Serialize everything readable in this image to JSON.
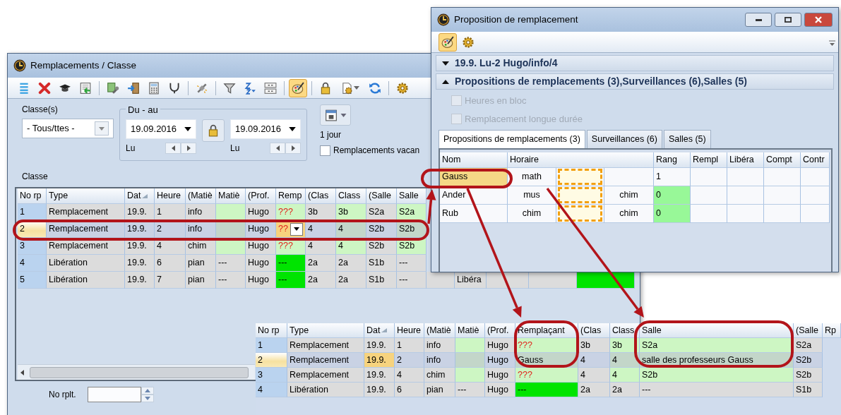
{
  "main_window": {
    "title": "Remplacements / Classe",
    "toolbar": [
      {
        "active": false
      },
      {
        "active": false
      },
      {
        "active": false
      },
      {
        "active": false
      },
      {
        "active": false
      },
      {
        "active": false
      },
      {
        "active": false
      },
      {
        "active": false
      },
      {
        "active": false
      },
      {
        "active": false
      },
      {
        "active": false
      },
      {
        "active": false
      },
      {
        "active": true
      },
      {
        "active": false
      },
      {
        "active": false
      },
      {
        "active": false
      },
      {
        "active": false
      }
    ],
    "filters": {
      "classes_label": "Classe(s)",
      "classes_value": "- Tous/ttes -",
      "range_label": "Du - au",
      "from_date": "19.09.2016",
      "from_day": "Lu",
      "to_date": "19.09.2016",
      "to_day": "Lu",
      "period": "1 jour",
      "vacant_label": "Remplacements vacan",
      "vacant_checked": false,
      "grouping_label": "Classe"
    },
    "table": {
      "columns": [
        "No rp",
        "Type",
        "Dat",
        "Heure",
        "(Matiè",
        "Matiè",
        "(Prof.",
        "Remp",
        "(Clas",
        "Class",
        "(Salle",
        "Salle"
      ],
      "rows": [
        {
          "selected": false,
          "kind": "replacement",
          "cells": [
            "1",
            "Remplacement",
            "19.9.",
            "1",
            "info",
            {
              "kind": "empty"
            },
            "Hugo",
            {
              "kind": "missing",
              "text": "???"
            },
            "3b",
            "3b",
            "S2a",
            "S2a"
          ]
        },
        {
          "selected": true,
          "kind": "replacement",
          "cells": [
            "2",
            "Remplacement",
            "19.9.",
            "2",
            "info",
            {
              "kind": "empty"
            },
            "Hugo",
            {
              "kind": "editing",
              "text": "??"
            },
            "4",
            "4",
            "S2b",
            "S2b"
          ]
        },
        {
          "selected": false,
          "kind": "replacement",
          "cells": [
            "3",
            "Remplacement",
            "19.9.",
            "4",
            "chim",
            {
              "kind": "empty"
            },
            "Hugo",
            {
              "kind": "missing",
              "text": "???"
            },
            "4",
            "4",
            "S2b",
            "S2b"
          ]
        },
        {
          "selected": false,
          "kind": "release",
          "cells": [
            "4",
            "Libération",
            "19.9.",
            "6",
            "pian",
            "---",
            "Hugo",
            {
              "kind": "released",
              "text": "---"
            },
            "2a",
            "2a",
            "S1b",
            "---"
          ]
        },
        {
          "selected": false,
          "kind": "release",
          "cells": [
            "5",
            "Libération",
            "19.9.",
            "7",
            "pian",
            "---",
            "Hugo",
            {
              "kind": "released",
              "text": "---"
            },
            "2a",
            "2a",
            "S1b",
            "---",
            {
              "kind": "empty"
            },
            "Libéra",
            {
              "kind": "empty"
            },
            {
              "kind": "empty"
            },
            {
              "kind": "released"
            }
          ]
        }
      ]
    },
    "footer": {
      "number_label": "No rplt."
    }
  },
  "proposal_window": {
    "title": "Proposition de remplacement",
    "toolbar": [
      {
        "active": true
      },
      {
        "active": false
      }
    ],
    "lesson_header": {
      "text": "19.9. Lu-2 Hugo/info/4",
      "expanded": false
    },
    "proposals_header": {
      "text": "Propositions de remplacements (3),Surveillances (6),Salles (5)",
      "expanded": true
    },
    "options": [
      {
        "label": "Heures en bloc",
        "checked": false,
        "disabled": true
      },
      {
        "label": "Remplacement longue durée",
        "checked": false,
        "disabled": true
      }
    ],
    "tabs": [
      {
        "label": "Propositions de remplacements (3)",
        "selected": true
      },
      {
        "label": "Surveillances (6)",
        "selected": false
      },
      {
        "label": "Salles (5)",
        "selected": false
      }
    ],
    "table": {
      "columns": [
        "Nom",
        "Horaire",
        "Rang",
        "Rempl",
        "Libéra",
        "Compt",
        "Contr"
      ],
      "rows": [
        {
          "selected": true,
          "name": "Gauss",
          "subject": "math",
          "rank": "1",
          "rank_ok": false
        },
        {
          "selected": false,
          "name": "Ander",
          "subject": "mus",
          "other_subject": "chim",
          "rank": "0",
          "rank_ok": true
        },
        {
          "selected": false,
          "name": "Rub",
          "subject": "chim",
          "other_subject": "chim",
          "rank": "0",
          "rank_ok": true
        }
      ]
    }
  },
  "detail_table": {
    "columns": [
      "No rp",
      "Type",
      "Dat",
      "Heure",
      "(Matiè",
      "Matiè",
      "(Prof.",
      "Remplaçant",
      "(Clas",
      "Class",
      "Salle",
      "(Salle",
      "Rp"
    ],
    "rows": [
      {
        "selected": false,
        "kind": "replacement",
        "cells": [
          "1",
          "Remplacement",
          "19.9.",
          "1",
          "info",
          {
            "kind": "empty"
          },
          "Hugo",
          {
            "kind": "missing",
            "text": "???"
          },
          "3b",
          "3b",
          "S2a",
          "S2a"
        ]
      },
      {
        "selected": true,
        "kind": "replacement",
        "cells": [
          "2",
          "Remplacement",
          {
            "kind": "current",
            "text": "19.9."
          },
          "2",
          "info",
          {
            "kind": "empty"
          },
          "Hugo",
          "Gauss",
          "4",
          "4",
          "salle des professeurs Gauss",
          "S2b"
        ]
      },
      {
        "selected": false,
        "kind": "replacement",
        "cells": [
          "3",
          "Remplacement",
          "19.9.",
          "4",
          "chim",
          {
            "kind": "empty"
          },
          "Hugo",
          {
            "kind": "missing",
            "text": "???"
          },
          "4",
          "4",
          "S2b",
          "S2b"
        ]
      },
      {
        "selected": false,
        "kind": "release",
        "cells": [
          "4",
          "Libération",
          "19.9.",
          "6",
          "pian",
          "---",
          "Hugo",
          {
            "kind": "released",
            "text": "---"
          },
          "2a",
          "2a",
          "---",
          "S1b"
        ]
      }
    ]
  }
}
